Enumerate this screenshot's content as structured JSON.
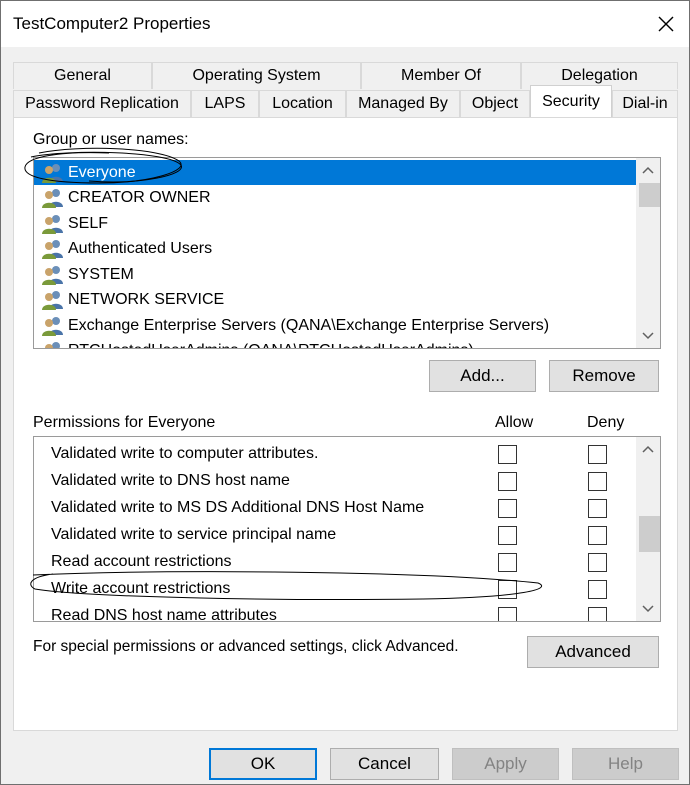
{
  "window": {
    "title": "TestComputer2 Properties"
  },
  "tabs_row1": [
    {
      "label": "General"
    },
    {
      "label": "Operating System"
    },
    {
      "label": "Member Of"
    },
    {
      "label": "Delegation"
    }
  ],
  "tabs_row2": [
    {
      "label": "Password Replication"
    },
    {
      "label": "LAPS"
    },
    {
      "label": "Location"
    },
    {
      "label": "Managed By"
    },
    {
      "label": "Object"
    },
    {
      "label": "Security",
      "active": true
    },
    {
      "label": "Dial-in"
    }
  ],
  "groups": {
    "label": "Group or user names:",
    "items": [
      {
        "name": "Everyone",
        "selected": true
      },
      {
        "name": "CREATOR OWNER"
      },
      {
        "name": "SELF"
      },
      {
        "name": "Authenticated Users"
      },
      {
        "name": "SYSTEM"
      },
      {
        "name": "NETWORK SERVICE"
      },
      {
        "name": "Exchange Enterprise Servers (QANA\\Exchange Enterprise Servers)"
      },
      {
        "name": "RTCHostedUserAdmins (QANA\\RTCHostedUserAdmins)"
      }
    ]
  },
  "buttons": {
    "add": "Add...",
    "remove": "Remove",
    "advanced": "Advanced",
    "ok": "OK",
    "cancel": "Cancel",
    "apply": "Apply",
    "help": "Help"
  },
  "permissions": {
    "label": "Permissions for Everyone",
    "allow_header": "Allow",
    "deny_header": "Deny",
    "items": [
      {
        "name": "Validated write to computer attributes.",
        "allow": false,
        "deny": false
      },
      {
        "name": "Validated write to DNS host name",
        "allow": false,
        "deny": false
      },
      {
        "name": "Validated write to MS DS Additional DNS Host Name",
        "allow": false,
        "deny": false
      },
      {
        "name": "Validated write to service principal name",
        "allow": false,
        "deny": false
      },
      {
        "name": "Read account restrictions",
        "allow": false,
        "deny": false
      },
      {
        "name": "Write account restrictions",
        "allow": false,
        "deny": false
      },
      {
        "name": "Read DNS host name attributes",
        "allow": false,
        "deny": false
      }
    ]
  },
  "advanced_hint": "For special permissions or advanced settings, click Advanced."
}
